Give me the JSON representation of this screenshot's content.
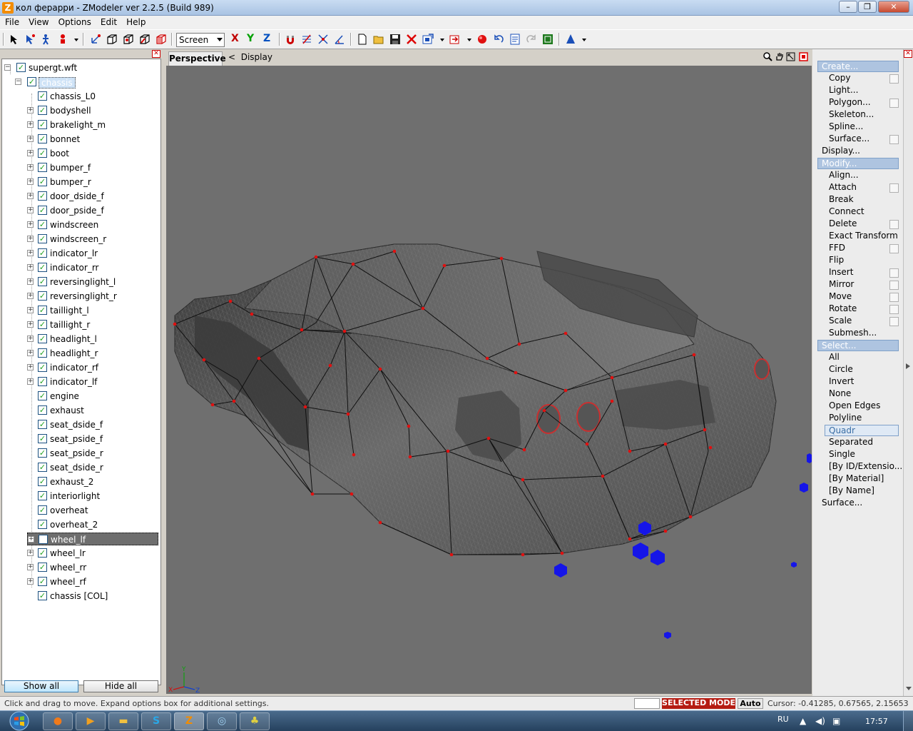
{
  "window": {
    "title": "кол ферарри - ZModeler ver 2.2.5 (Build 989)",
    "app_icon_letter": "Z",
    "buttons": {
      "minimize": "–",
      "maximize": "❐",
      "close": "✕"
    }
  },
  "menu": [
    "File",
    "View",
    "Options",
    "Edit",
    "Help"
  ],
  "toolbar": {
    "coord_space": "Screen",
    "axes": [
      {
        "label": "X",
        "color": "#c00000"
      },
      {
        "label": "Y",
        "color": "#00a000"
      },
      {
        "label": "Z",
        "color": "#0050c0"
      }
    ]
  },
  "tree": {
    "root": "supergt.wft",
    "group": "chassis",
    "items": [
      {
        "label": "chassis_L0",
        "expandable": false,
        "checked": true
      },
      {
        "label": "bodyshell",
        "expandable": true,
        "checked": true
      },
      {
        "label": "brakelight_m",
        "expandable": true,
        "checked": true
      },
      {
        "label": "bonnet",
        "expandable": true,
        "checked": true
      },
      {
        "label": "boot",
        "expandable": true,
        "checked": true
      },
      {
        "label": "bumper_f",
        "expandable": true,
        "checked": true
      },
      {
        "label": "bumper_r",
        "expandable": true,
        "checked": true
      },
      {
        "label": "door_dside_f",
        "expandable": true,
        "checked": true
      },
      {
        "label": "door_pside_f",
        "expandable": true,
        "checked": true
      },
      {
        "label": "windscreen",
        "expandable": true,
        "checked": true
      },
      {
        "label": "windscreen_r",
        "expandable": true,
        "checked": true
      },
      {
        "label": "indicator_lr",
        "expandable": true,
        "checked": true
      },
      {
        "label": "indicator_rr",
        "expandable": true,
        "checked": true
      },
      {
        "label": "reversinglight_l",
        "expandable": true,
        "checked": true
      },
      {
        "label": "reversinglight_r",
        "expandable": true,
        "checked": true
      },
      {
        "label": "taillight_l",
        "expandable": true,
        "checked": true
      },
      {
        "label": "taillight_r",
        "expandable": true,
        "checked": true
      },
      {
        "label": "headlight_l",
        "expandable": true,
        "checked": true
      },
      {
        "label": "headlight_r",
        "expandable": true,
        "checked": true
      },
      {
        "label": "indicator_rf",
        "expandable": true,
        "checked": true
      },
      {
        "label": "indicator_lf",
        "expandable": true,
        "checked": true
      },
      {
        "label": "engine",
        "expandable": false,
        "checked": true
      },
      {
        "label": "exhaust",
        "expandable": false,
        "checked": true
      },
      {
        "label": "seat_dside_f",
        "expandable": false,
        "checked": true
      },
      {
        "label": "seat_pside_f",
        "expandable": false,
        "checked": true
      },
      {
        "label": "seat_pside_r",
        "expandable": false,
        "checked": true
      },
      {
        "label": "seat_dside_r",
        "expandable": false,
        "checked": true
      },
      {
        "label": "exhaust_2",
        "expandable": false,
        "checked": true
      },
      {
        "label": "interiorlight",
        "expandable": false,
        "checked": true
      },
      {
        "label": "overheat",
        "expandable": false,
        "checked": true
      },
      {
        "label": "overheat_2",
        "expandable": false,
        "checked": true
      },
      {
        "label": "wheel_lf",
        "expandable": true,
        "checked": false,
        "highlighted": true
      },
      {
        "label": "wheel_lr",
        "expandable": true,
        "checked": true
      },
      {
        "label": "wheel_rr",
        "expandable": true,
        "checked": true
      },
      {
        "label": "wheel_rf",
        "expandable": true,
        "checked": true
      },
      {
        "label": "chassis [COL]",
        "expandable": false,
        "checked": true
      }
    ],
    "show_all": "Show all",
    "hide_all": "Hide all"
  },
  "viewport": {
    "tab": "Perspective",
    "breadcrumb_arrow": "<",
    "breadcrumb": "Display"
  },
  "commands": [
    {
      "label": "Create...",
      "level": 0,
      "header": true
    },
    {
      "label": "Copy",
      "level": 1,
      "option": true
    },
    {
      "label": "Light...",
      "level": 1
    },
    {
      "label": "Polygon...",
      "level": 1,
      "option": true
    },
    {
      "label": "Skeleton...",
      "level": 1
    },
    {
      "label": "Spline...",
      "level": 1
    },
    {
      "label": "Surface...",
      "level": 1,
      "option": true
    },
    {
      "label": "Display...",
      "level": 0
    },
    {
      "label": "Modify...",
      "level": 0,
      "header": true
    },
    {
      "label": "Align...",
      "level": 1
    },
    {
      "label": "Attach",
      "level": 1,
      "option": true
    },
    {
      "label": "Break",
      "level": 1
    },
    {
      "label": "Connect",
      "level": 1
    },
    {
      "label": "Delete",
      "level": 1,
      "option": true
    },
    {
      "label": "Exact Transform",
      "level": 1
    },
    {
      "label": "FFD",
      "level": 1,
      "option": true
    },
    {
      "label": "Flip",
      "level": 1
    },
    {
      "label": "Insert",
      "level": 1,
      "option": true
    },
    {
      "label": "Mirror",
      "level": 1,
      "option": true
    },
    {
      "label": "Move",
      "level": 1,
      "option": true
    },
    {
      "label": "Rotate",
      "level": 1,
      "option": true
    },
    {
      "label": "Scale",
      "level": 1,
      "option": true
    },
    {
      "label": "Submesh...",
      "level": 1
    },
    {
      "label": "Select...",
      "level": 0,
      "header": true
    },
    {
      "label": "All",
      "level": 1
    },
    {
      "label": "Circle",
      "level": 1
    },
    {
      "label": "Invert",
      "level": 1
    },
    {
      "label": "None",
      "level": 1
    },
    {
      "label": "Open Edges",
      "level": 1
    },
    {
      "label": "Polyline",
      "level": 1
    },
    {
      "label": "Quadr",
      "level": 1,
      "selected": true
    },
    {
      "label": "Separated",
      "level": 1
    },
    {
      "label": "Single",
      "level": 1
    },
    {
      "label": "[By ID/Extensio...",
      "level": 1
    },
    {
      "label": "[By Material]",
      "level": 1
    },
    {
      "label": "[By Name]",
      "level": 1
    },
    {
      "label": "Surface...",
      "level": 0
    }
  ],
  "status": {
    "hint": "Click and drag to move. Expand options box for additional settings.",
    "mode": "SELECTED MODE",
    "auto": "Auto",
    "cursor": "Cursor: -0.41285, 0.67565, 2.15653"
  },
  "taskbar": {
    "lang": "RU",
    "clock": "17:57"
  },
  "colors": {
    "viewport_bg": "#6f6f6f",
    "vertex": "#e01010",
    "helper_cube": "#1515e8",
    "selected_mode": "#b51c12"
  }
}
